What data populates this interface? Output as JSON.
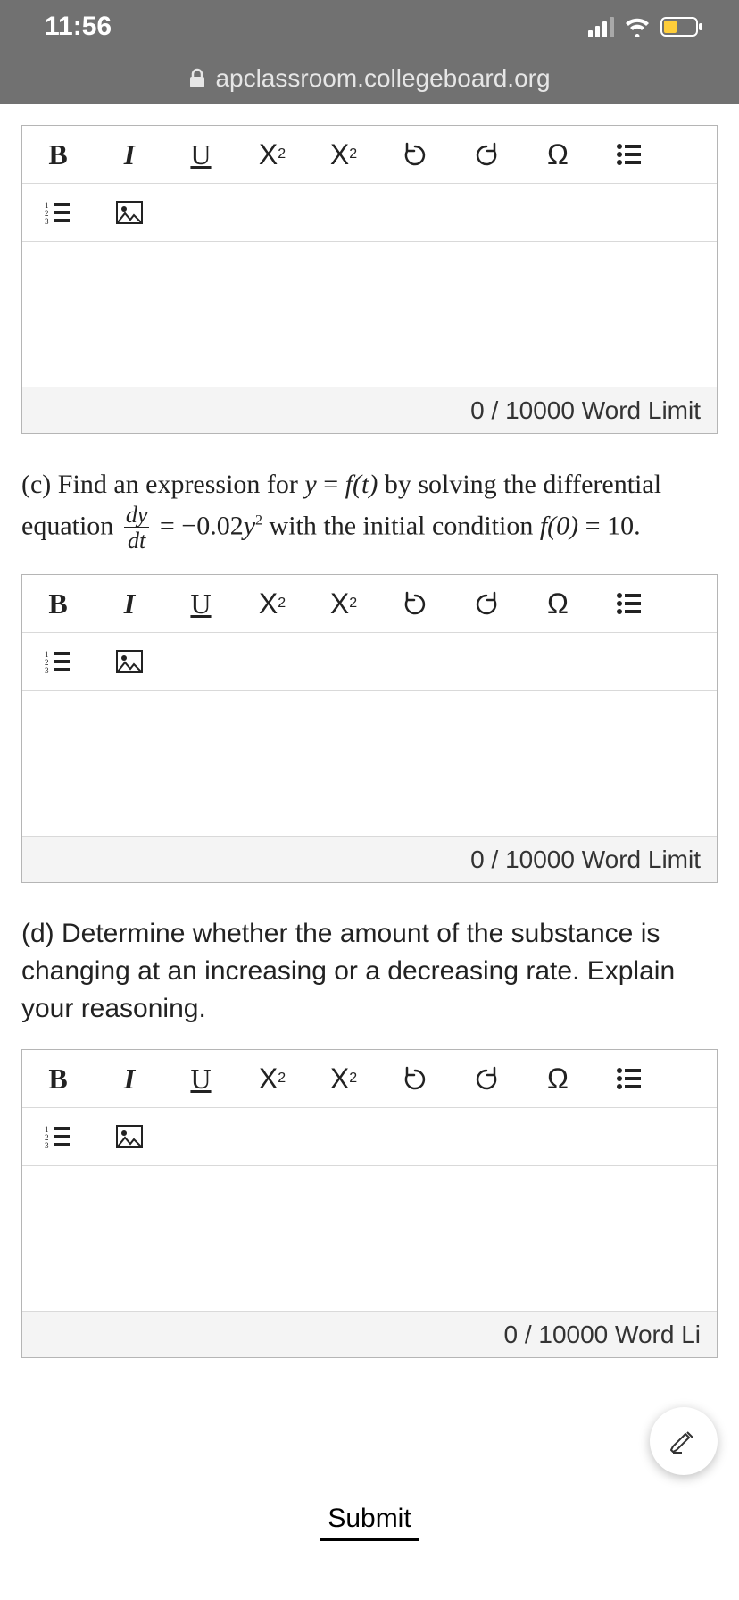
{
  "status": {
    "time": "11:56"
  },
  "url": "apclassroom.collegeboard.org",
  "toolbar": {
    "bold": "B",
    "italic": "I",
    "underline": "U",
    "sup_base": "X",
    "sup_exp": "2",
    "sub_base": "X",
    "sub_sub": "2",
    "omega": "Ω"
  },
  "editors": [
    {
      "footer": "0 / 10000 Word Limit"
    },
    {
      "footer": "0 / 10000 Word Limit"
    },
    {
      "footer": "0 / 10000 Word Li"
    }
  ],
  "questions": {
    "c_prefix": "(c) Find an expression for ",
    "c_y": "y",
    "c_eq1": " = ",
    "c_ft": "f(t)",
    "c_mid": " by solving the differential equation ",
    "c_frac_n": "dy",
    "c_frac_d": "dt",
    "c_eq2": " = ",
    "c_rhs_a": "−0.02",
    "c_rhs_b": "y",
    "c_rhs_exp": "2",
    "c_mid2": " with the initial condition ",
    "c_f0": "f(0)",
    "c_eq3": " = ",
    "c_ten": "10",
    "c_period": ".",
    "d": "(d) Determine whether the amount of the substance is changing at an increasing or a decreasing rate. Explain your reasoning."
  },
  "submit": "Submit"
}
